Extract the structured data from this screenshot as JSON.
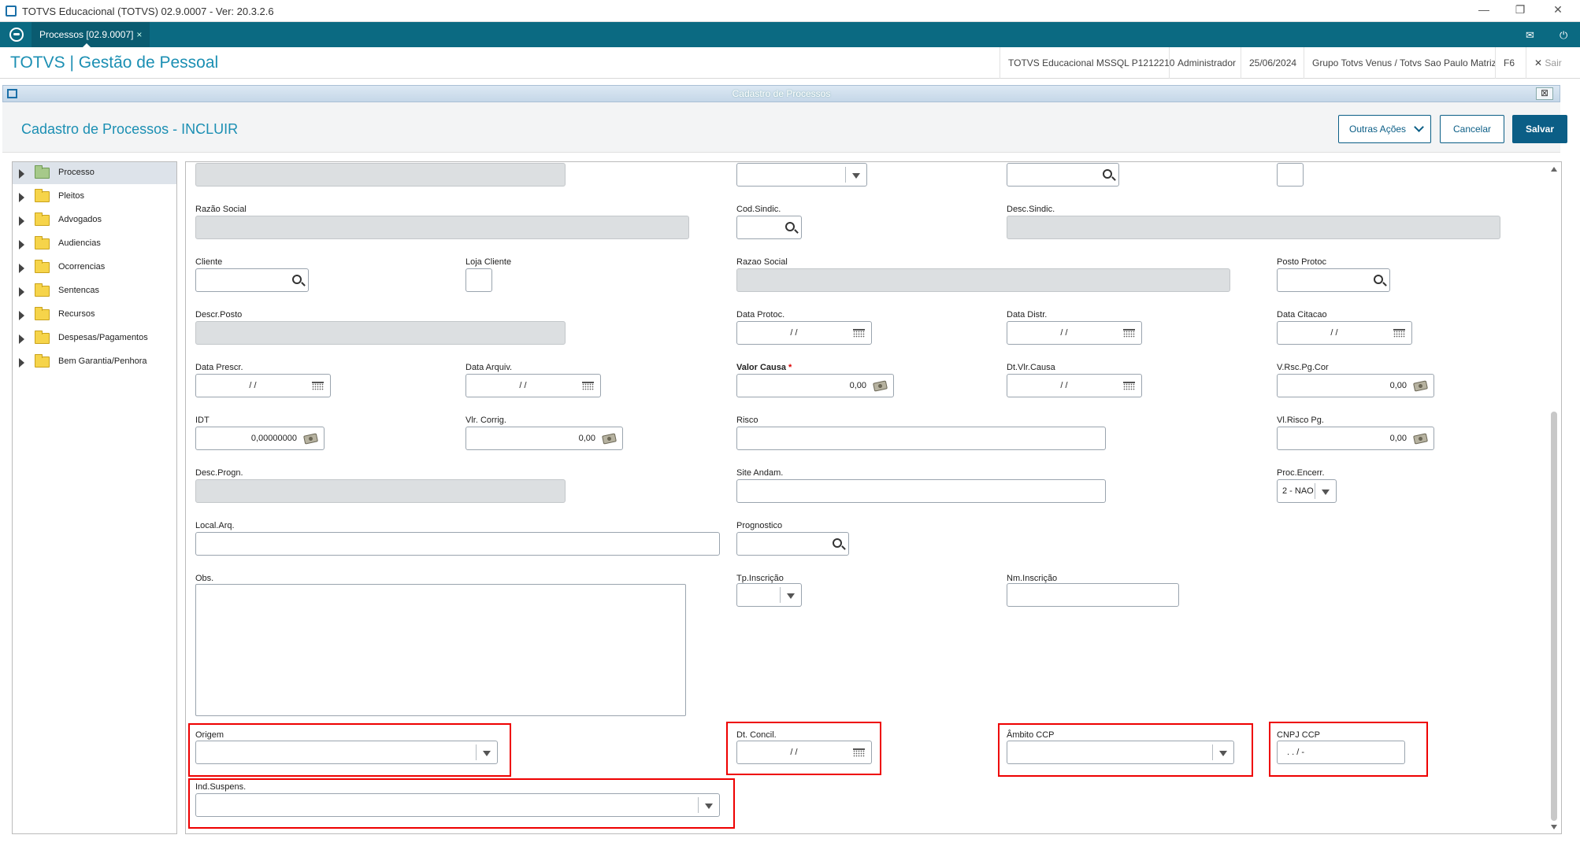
{
  "window": {
    "title": "TOTVS Educacional (TOTVS) 02.9.0007 - Ver: 20.3.2.6",
    "minimize": "—",
    "restore": "❐",
    "close": "✕"
  },
  "tabbar": {
    "tab_label": "Processos [02.9.0007]",
    "tab_close": "×",
    "mail_icon": "✉",
    "power_icon": "⏻"
  },
  "header": {
    "brand": "TOTVS | Gestão de Pessoal",
    "environment": "TOTVS Educacional MSSQL P1212210",
    "user": "Administrador",
    "date": "25/06/2024",
    "company": "Grupo Totvs Venus / Totvs Sao Paulo Matriz",
    "f6": "F6",
    "exit": "Sair",
    "exit_icon": "✕"
  },
  "dialog": {
    "bar_title": "Cadastro de Processos",
    "close_icon": "⊠",
    "heading": "Cadastro de Processos - INCLUIR",
    "more_actions": "Outras Ações",
    "cancel": "Cancelar",
    "save": "Salvar"
  },
  "tree": [
    {
      "label": "Processo",
      "selected": true
    },
    {
      "label": "Pleitos",
      "selected": false
    },
    {
      "label": "Advogados",
      "selected": false
    },
    {
      "label": "Audiencias",
      "selected": false
    },
    {
      "label": "Ocorrencias",
      "selected": false
    },
    {
      "label": "Sentencas",
      "selected": false
    },
    {
      "label": "Recursos",
      "selected": false
    },
    {
      "label": "Despesas/Pagamentos",
      "selected": false
    },
    {
      "label": "Bem Garantia/Penhora",
      "selected": false
    }
  ],
  "form": {
    "razao_social": {
      "label": "Razão Social"
    },
    "cod_sindic": {
      "label": "Cod.Sindic."
    },
    "desc_sindic": {
      "label": "Desc.Sindic."
    },
    "cliente": {
      "label": "Cliente"
    },
    "loja_cliente": {
      "label": "Loja Cliente"
    },
    "razao_social2": {
      "label": "Razao Social"
    },
    "posto_protoc": {
      "label": "Posto Protoc"
    },
    "descr_posto": {
      "label": "Descr.Posto"
    },
    "data_protoc": {
      "label": "Data Protoc.",
      "value": "/ /"
    },
    "data_distr": {
      "label": "Data Distr.",
      "value": "/ /"
    },
    "data_citacao": {
      "label": "Data Citacao",
      "value": "/ /"
    },
    "data_prescr": {
      "label": "Data Prescr.",
      "value": "/ /"
    },
    "data_arquiv": {
      "label": "Data Arquiv.",
      "value": "/ /"
    },
    "valor_causa": {
      "label": "Valor Causa",
      "required_mark": "*",
      "value": "0,00"
    },
    "dt_vlr_causa": {
      "label": "Dt.Vlr.Causa",
      "value": "/ /"
    },
    "v_rsc_pg_cor": {
      "label": "V.Rsc.Pg.Cor",
      "value": "0,00"
    },
    "idt": {
      "label": "IDT",
      "value": "0,00000000"
    },
    "vlr_corrig": {
      "label": "Vlr. Corrig.",
      "value": "0,00"
    },
    "risco": {
      "label": "Risco"
    },
    "vl_risco_pg": {
      "label": "Vl.Risco Pg.",
      "value": "0,00"
    },
    "desc_progn": {
      "label": "Desc.Progn."
    },
    "site_andam": {
      "label": "Site Andam."
    },
    "proc_encerr": {
      "label": "Proc.Encerr.",
      "value": "2 - NAO"
    },
    "local_arq": {
      "label": "Local.Arq."
    },
    "prognostico": {
      "label": "Prognostico"
    },
    "obs": {
      "label": "Obs."
    },
    "tp_inscricao": {
      "label": "Tp.Inscrição"
    },
    "nm_inscricao": {
      "label": "Nm.Inscrição"
    },
    "origem": {
      "label": "Origem"
    },
    "dt_concil": {
      "label": "Dt. Concil.",
      "value": "/ /"
    },
    "ambito_ccp": {
      "label": "Âmbito CCP"
    },
    "cnpj_ccp": {
      "label": "CNPJ CCP",
      "value": ".  .  /    -"
    },
    "ind_suspens": {
      "label": "Ind.Suspens."
    }
  }
}
